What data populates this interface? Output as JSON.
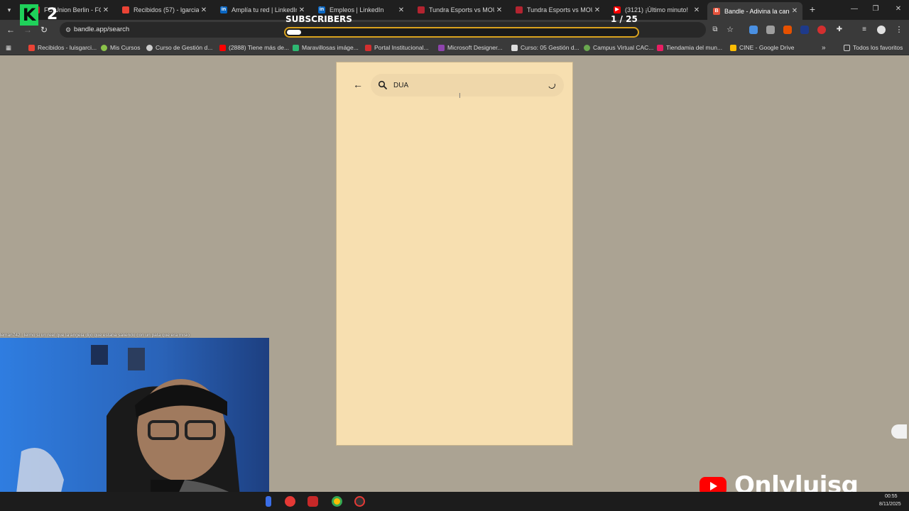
{
  "browser": {
    "tabs": [
      {
        "title": "FC Union Berlin - FC Ba",
        "favicon_color": "#c8102e"
      },
      {
        "title": "Recibidos (57) - lgarciad",
        "favicon_color": "#ea4335"
      },
      {
        "title": "Amplía tu red | LinkedIn",
        "favicon_color": "#0a66c2"
      },
      {
        "title": "Empleos | LinkedIn",
        "favicon_color": "#0a66c2"
      },
      {
        "title": "Tundra Esports vs MOUZ",
        "favicon_color": "#b32430"
      },
      {
        "title": "Tundra Esports vs MOUZ",
        "favicon_color": "#b32430"
      },
      {
        "title": "(3121) ¡Último minuto!",
        "favicon_color": "#ff0000"
      },
      {
        "title": "Bandle - Adivina la canción",
        "favicon_color": "#e6533c",
        "active": true
      }
    ],
    "url": "bandle.app/search",
    "bookmarks": [
      {
        "label": "Recibidos - luisgarci...",
        "color": "#ea4335"
      },
      {
        "label": "Mis Cursos",
        "color": "#8bc34a"
      },
      {
        "label": "Curso de Gestión d...",
        "color": "#cccccc"
      },
      {
        "label": "(2888) Tiene más de...",
        "color": "#ff0000"
      },
      {
        "label": "Maravillosas imáge...",
        "color": "#2eb872"
      },
      {
        "label": "Portal Institucional...",
        "color": "#d32f2f"
      },
      {
        "label": "Microsoft Designer...",
        "color": "#8e44ad"
      },
      {
        "label": "Curso: 05 Gestión d...",
        "color": "#dddddd"
      },
      {
        "label": "Campus Virtual CAC...",
        "color": "#6aa84f"
      },
      {
        "label": "Tiendamia del mun...",
        "color": "#e91e63"
      },
      {
        "label": "CINE - Google Drive",
        "color": "#fbbc04"
      }
    ],
    "all_bookmarks_label": "Todos los favoritos"
  },
  "overlay": {
    "subscribers_label": "SUBSCRIBERS",
    "subscribers_count": "1 / 25",
    "goal_progress": 0.04,
    "logo_letter": "K",
    "logo_number": "2",
    "channel_name": "Onlyluisg",
    "chat_message": "leman742 : lelmo si un reel que la angela dijo que estaba saliendo con un pata que era misio"
  },
  "bandle": {
    "search_value": "DUA"
  },
  "taskbar": {
    "time": "00:55",
    "date": "8/11/2025"
  }
}
